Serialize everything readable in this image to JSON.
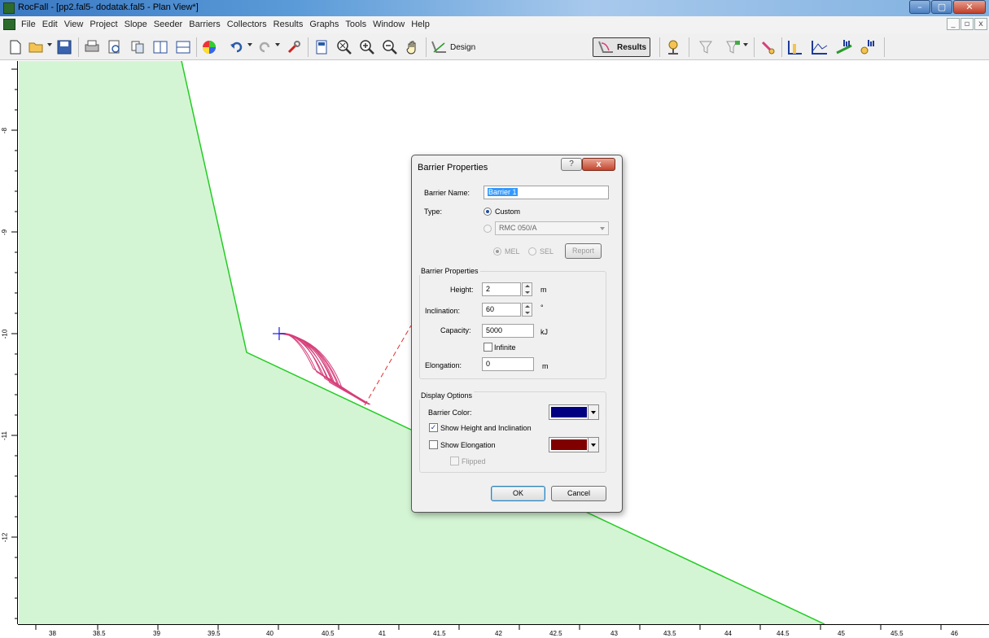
{
  "window": {
    "title": "RocFall - [pp2.fal5- dodatak.fal5 - Plan View*]",
    "controls": [
      "–",
      "▢",
      "✕"
    ]
  },
  "menu": {
    "items": [
      "File",
      "Edit",
      "View",
      "Project",
      "Slope",
      "Seeder",
      "Barriers",
      "Collectors",
      "Results",
      "Graphs",
      "Tools",
      "Window",
      "Help"
    ],
    "mdi_controls": [
      "_",
      "▫",
      "x"
    ]
  },
  "toolbar": {
    "design_label": "Design",
    "results_label": "Results",
    "icons": [
      "new-icon",
      "open-icon",
      "save-icon",
      "print-icon",
      "print-preview-icon",
      "copy-icon",
      "tile-vertical-icon",
      "tile-horizontal-icon",
      "color-wheel-icon",
      "undo-icon",
      "redo-icon",
      "wrench-icon",
      "info-icon",
      "zoom-all-icon",
      "zoom-in-icon",
      "zoom-out-icon",
      "pan-icon",
      "design-icon",
      "results-icon",
      "probe-icon",
      "filter-icon",
      "filter-options-icon",
      "highlight-icon",
      "graph-endpoints-icon",
      "graph-path-icon",
      "graph-histogram-icon",
      "graph-energy-icon"
    ]
  },
  "rulers": {
    "x_ticks": [
      "38",
      "38.5",
      "39",
      "39.5",
      "40",
      "40.5",
      "41",
      "41.5",
      "42",
      "42.5",
      "43",
      "43.5",
      "44",
      "44.5",
      "45",
      "45.5",
      "46"
    ],
    "y_ticks": [
      "-8",
      "-9",
      "-10",
      "-11",
      "-12"
    ]
  },
  "colors": {
    "slope_fill": "#d4f5d4",
    "slope_line": "#22cc22",
    "trajectory": "#d63f7a",
    "barrier_line": "#e03030",
    "seeder": "#1a1aee"
  },
  "dialog": {
    "title": "Barrier Properties",
    "help": "?",
    "close": "x",
    "name_label": "Barrier Name:",
    "name_value": "Barrier 1",
    "type_label": "Type:",
    "type_custom": "Custom",
    "type_preset": "RMC 050/A",
    "mel": "MEL",
    "sel": "SEL",
    "report": "Report",
    "props_group": "Barrier Properties",
    "height_label": "Height:",
    "height_value": "2",
    "height_unit": "m",
    "incl_label": "Inclination:",
    "incl_value": "60",
    "incl_unit": "°",
    "cap_label": "Capacity:",
    "cap_value": "5000",
    "cap_unit": "kJ",
    "infinite_label": "Infinite",
    "elong_label": "Elongation:",
    "elong_value": "0",
    "elong_unit": "m",
    "display_group": "Display Options",
    "barrier_color_label": "Barrier Color:",
    "barrier_color": "#000080",
    "show_height_label": "Show Height and Inclination",
    "show_elong_label": "Show Elongation",
    "elong_color": "#800000",
    "flipped_label": "Flipped",
    "ok": "OK",
    "cancel": "Cancel"
  }
}
